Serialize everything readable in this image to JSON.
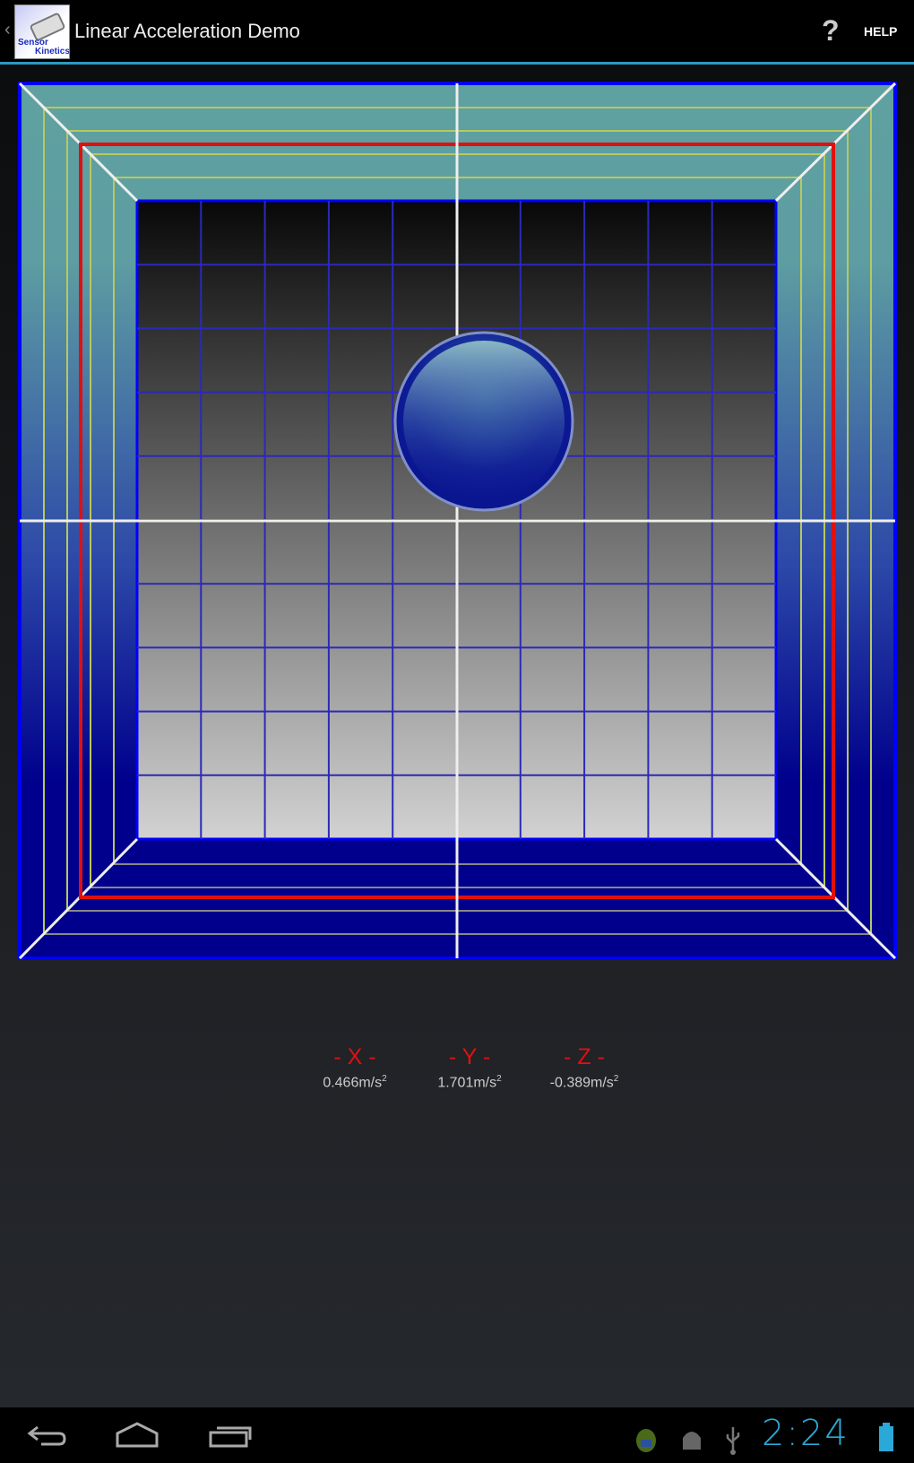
{
  "action_bar": {
    "title": "Linear Acceleration Demo",
    "logo_text": [
      "Sensor",
      "Kinetics"
    ],
    "help_label": "HELP",
    "help_icon": "?"
  },
  "readouts": [
    {
      "axis": "- X -",
      "value": "0.466m/s",
      "unit_exp": "2"
    },
    {
      "axis": "- Y -",
      "value": "1.701m/s",
      "unit_exp": "2"
    },
    {
      "axis": "- Z -",
      "value": "-0.389m/s",
      "unit_exp": "2"
    }
  ],
  "status_bar": {
    "time": "2:24"
  },
  "colors": {
    "accent": "#2a9ac4",
    "axis_label": "#e01010",
    "frame": "#0000ff",
    "target": "#e01010"
  }
}
